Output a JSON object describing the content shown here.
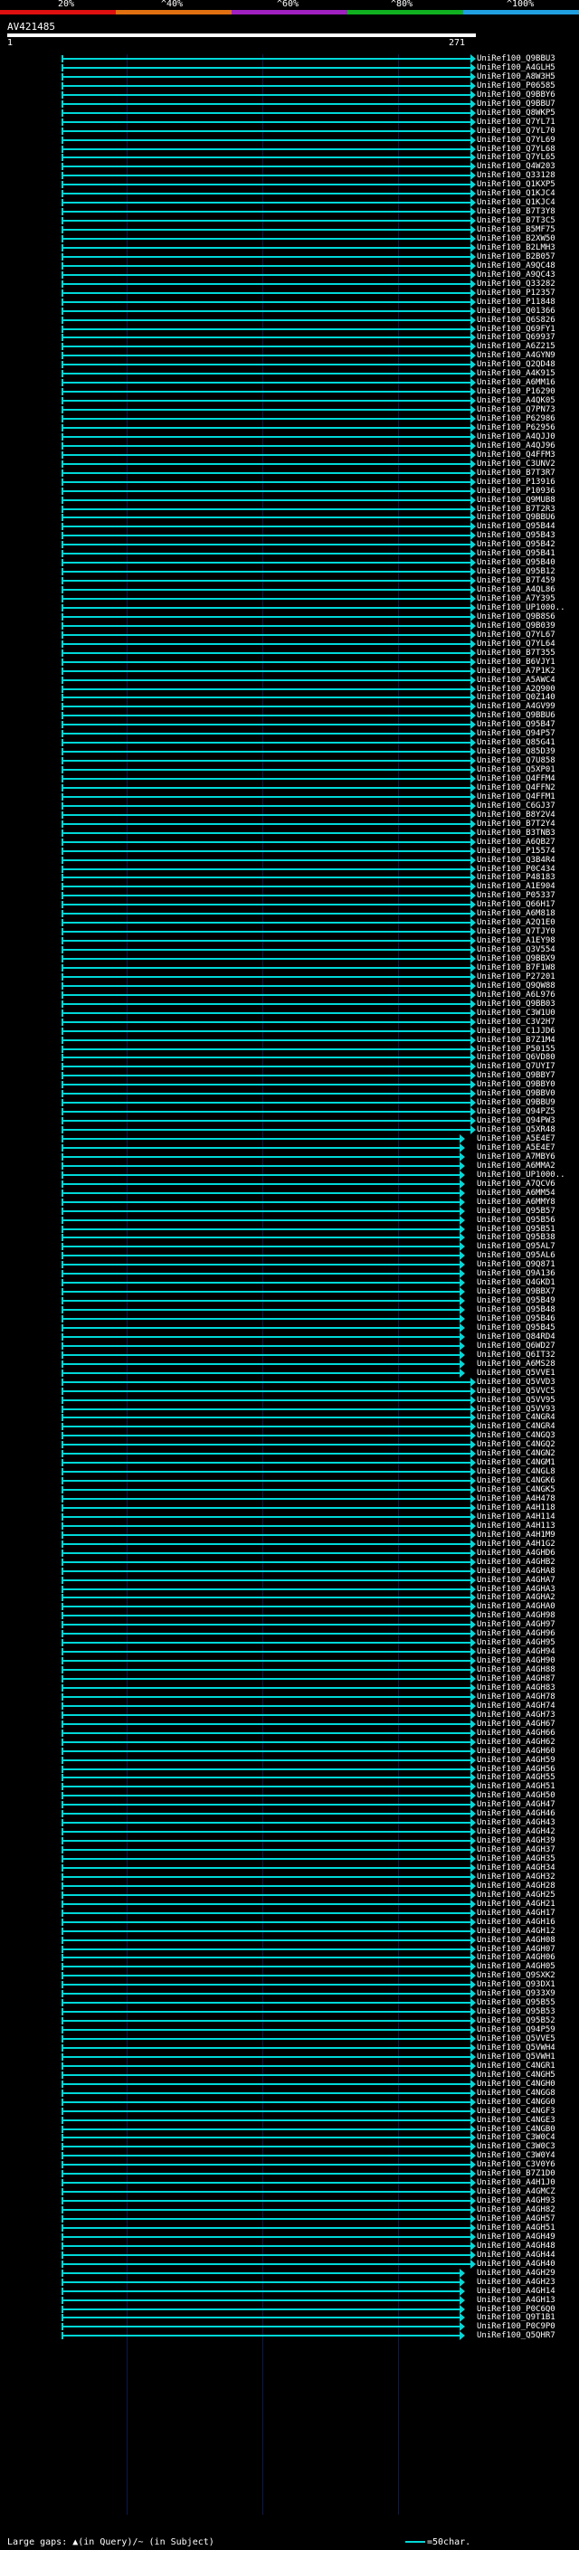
{
  "scale": {
    "labels": [
      "20%",
      "^40%",
      "^60%",
      "^80%",
      "^100%"
    ],
    "colors": [
      "#e01010",
      "#e07010",
      "#a020c0",
      "#10b020",
      "#20a0e0"
    ]
  },
  "query": {
    "title": "AV421485",
    "start": "1",
    "end": "271"
  },
  "hit_color": "#00d8d8",
  "hits": [
    "UniRef100_Q9BBU3",
    "UniRef100_A4GLH5",
    "UniRef100_A8W3H5",
    "UniRef100_P06585",
    "UniRef100_Q9BBY6",
    "UniRef100_Q9BBU7",
    "UniRef100_Q8WKP5",
    "UniRef100_Q7YL71",
    "UniRef100_Q7YL70",
    "UniRef100_Q7YL69",
    "UniRef100_Q7YL68",
    "UniRef100_Q7YL65",
    "UniRef100_Q4W203",
    "UniRef100_Q33128",
    "UniRef100_Q1KXP5",
    "UniRef100_Q1KJC4",
    "UniRef100_Q1KJC4",
    "UniRef100_B7T3Y8",
    "UniRef100_B7T3C5",
    "UniRef100_B5MF75",
    "UniRef100_B2XW50",
    "UniRef100_B2LMH3",
    "UniRef100_B2B057",
    "UniRef100_A9QC48",
    "UniRef100_A9QC43",
    "UniRef100_Q33282",
    "UniRef100_P12357",
    "UniRef100_P11848",
    "UniRef100_Q01366",
    "UniRef100_Q6S826",
    "UniRef100_Q69FY1",
    "UniRef100_Q69937",
    "UniRef100_A6Z215",
    "UniRef100_A4GYN9",
    "UniRef100_Q2QD48",
    "UniRef100_A4K915",
    "UniRef100_A6MM16",
    "UniRef100_P16290",
    "UniRef100_A4QK05",
    "UniRef100_Q7PN73",
    "UniRef100_P62986",
    "UniRef100_P62956",
    "UniRef100_A4QJJ0",
    "UniRef100_A4QJ96",
    "UniRef100_Q4FFM3",
    "UniRef100_C3UNV2",
    "UniRef100_B7T3R7",
    "UniRef100_P13916",
    "UniRef100_P10936",
    "UniRef100_Q9MUB8",
    "UniRef100_B7T2R3",
    "UniRef100_Q9BBU6",
    "UniRef100_Q95B44",
    "UniRef100_Q95B43",
    "UniRef100_Q95B42",
    "UniRef100_Q95B41",
    "UniRef100_Q95B40",
    "UniRef100_Q95B12",
    "UniRef100_B7T459",
    "UniRef100_A4QL86",
    "UniRef100_A7Y395",
    "UniRef100_UP1000..",
    "UniRef100_Q9B8S6",
    "UniRef100_Q9B039",
    "UniRef100_Q7YL67",
    "UniRef100_Q7YL64",
    "UniRef100_B7T355",
    "UniRef100_B6VJY1",
    "UniRef100_A7P1K2",
    "UniRef100_A5AWC4",
    "UniRef100_A2Q900",
    "UniRef100_Q0Z140",
    "UniRef100_A4GV99",
    "UniRef100_Q9BBU6",
    "UniRef100_Q95B47",
    "UniRef100_Q94P57",
    "UniRef100_Q85G41",
    "UniRef100_Q85D39",
    "UniRef100_Q7U858",
    "UniRef100_Q5XP01",
    "UniRef100_Q4FFM4",
    "UniRef100_Q4FFN2",
    "UniRef100_Q4FFM1",
    "UniRef100_C6GJ37",
    "UniRef100_B8Y2V4",
    "UniRef100_B7T2Y4",
    "UniRef100_B3TNB3",
    "UniRef100_A6QB27",
    "UniRef100_P15574",
    "UniRef100_Q3B4R4",
    "UniRef100_P0C434",
    "UniRef100_P48183",
    "UniRef100_A1E904",
    "UniRef100_P05337",
    "UniRef100_Q66H17",
    "UniRef100_A6M818",
    "UniRef100_A2Q1E0",
    "UniRef100_Q7TJY0",
    "UniRef100_A1EY98",
    "UniRef100_Q3V554",
    "UniRef100_Q9BBX9",
    "UniRef100_B7F1W8",
    "UniRef100_P27201",
    "UniRef100_Q9QW88",
    "UniRef100_A6L976",
    "UniRef100_Q9BB03",
    "UniRef100_C3W1U0",
    "UniRef100_C3V2H7",
    "UniRef100_C1JJD6",
    "UniRef100_B7Z1M4",
    "UniRef100_P50155",
    "UniRef100_Q6VD80",
    "UniRef100_Q7UYI7",
    "UniRef100_Q9BBY7",
    "UniRef100_Q9BBY0",
    "UniRef100_Q9BBV0",
    "UniRef100_Q9BBU9",
    "UniRef100_Q94PZ5",
    "UniRef100_Q94PW3",
    "UniRef100_Q5XR48",
    "UniRef100_A5E4E7",
    "UniRef100_A5E4E7",
    "UniRef100_A7MBY6",
    "UniRef100_A6MMA2",
    "UniRef100_UP1000..",
    "UniRef100_A7QCV6",
    "UniRef100_A6MM54",
    "UniRef100_A6MMY8",
    "UniRef100_Q95B57",
    "UniRef100_Q95B56",
    "UniRef100_Q95B51",
    "UniRef100_Q95B38",
    "UniRef100_Q95AL7",
    "UniRef100_Q95AL6",
    "UniRef100_Q9Q871",
    "UniRef100_Q9A136",
    "UniRef100_Q4GKD1",
    "UniRef100_Q9BBX7",
    "UniRef100_Q95B49",
    "UniRef100_Q95B48",
    "UniRef100_Q95B46",
    "UniRef100_Q95B45",
    "UniRef100_Q84RD4",
    "UniRef100_Q6WD27",
    "UniRef100_Q6IT32",
    "UniRef100_A6MS28",
    "UniRef100_Q5VVE1",
    "UniRef100_Q5VVD3",
    "UniRef100_Q5VVC5",
    "UniRef100_Q5VV95",
    "UniRef100_Q5VV93",
    "UniRef100_C4NGR4",
    "UniRef100_C4NGR4",
    "UniRef100_C4NGQ3",
    "UniRef100_C4NGQ2",
    "UniRef100_C4NGN2",
    "UniRef100_C4NGM1",
    "UniRef100_C4NGL8",
    "UniRef100_C4NGK6",
    "UniRef100_C4NGK5",
    "UniRef100_A4H478",
    "UniRef100_A4H118",
    "UniRef100_A4H114",
    "UniRef100_A4H113",
    "UniRef100_A4H1M9",
    "UniRef100_A4H1G2",
    "UniRef100_A4GHD6",
    "UniRef100_A4GHB2",
    "UniRef100_A4GHA8",
    "UniRef100_A4GHA7",
    "UniRef100_A4GHA3",
    "UniRef100_A4GHA2",
    "UniRef100_A4GHA0",
    "UniRef100_A4GH98",
    "UniRef100_A4GH97",
    "UniRef100_A4GH96",
    "UniRef100_A4GH95",
    "UniRef100_A4GH94",
    "UniRef100_A4GH90",
    "UniRef100_A4GH88",
    "UniRef100_A4GH87",
    "UniRef100_A4GH83",
    "UniRef100_A4GH78",
    "UniRef100_A4GH74",
    "UniRef100_A4GH73",
    "UniRef100_A4GH67",
    "UniRef100_A4GH66",
    "UniRef100_A4GH62",
    "UniRef100_A4GH60",
    "UniRef100_A4GH59",
    "UniRef100_A4GH56",
    "UniRef100_A4GH55",
    "UniRef100_A4GH51",
    "UniRef100_A4GH50",
    "UniRef100_A4GH47",
    "UniRef100_A4GH46",
    "UniRef100_A4GH43",
    "UniRef100_A4GH42",
    "UniRef100_A4GH39",
    "UniRef100_A4GH37",
    "UniRef100_A4GH35",
    "UniRef100_A4GH34",
    "UniRef100_A4GH32",
    "UniRef100_A4GH28",
    "UniRef100_A4GH25",
    "UniRef100_A4GH21",
    "UniRef100_A4GH17",
    "UniRef100_A4GH16",
    "UniRef100_A4GH12",
    "UniRef100_A4GH08",
    "UniRef100_A4GH07",
    "UniRef100_A4GH06",
    "UniRef100_A4GH05",
    "UniRef100_Q9SXK2",
    "UniRef100_Q93DX1",
    "UniRef100_Q933X9",
    "UniRef100_Q95B55",
    "UniRef100_Q95B53",
    "UniRef100_Q95B52",
    "UniRef100_Q94P59",
    "UniRef100_Q5VVE5",
    "UniRef100_Q5VWH4",
    "UniRef100_Q5VWH1",
    "UniRef100_C4NGR1",
    "UniRef100_C4NGH5",
    "UniRef100_C4NGH0",
    "UniRef100_C4NGG8",
    "UniRef100_C4NGG0",
    "UniRef100_C4NGF3",
    "UniRef100_C4NGE3",
    "UniRef100_C4NGB0",
    "UniRef100_C3W0C4",
    "UniRef100_C3W0C3",
    "UniRef100_C3W0Y4",
    "UniRef100_C3V0Y6",
    "UniRef100_B7Z1D0",
    "UniRef100_A4H1J0",
    "UniRef100_A4GMCZ",
    "UniRef100_A4GH93",
    "UniRef100_A4GH82",
    "UniRef100_A4GH57",
    "UniRef100_A4GH51",
    "UniRef100_A4GH49",
    "UniRef100_A4GH48",
    "UniRef100_A4GH44",
    "UniRef100_A4GH40",
    "UniRef100_A4GH29",
    "UniRef100_A4GH23",
    "UniRef100_A4GH14",
    "UniRef100_A4GH13",
    "UniRef100_P0C6Q0",
    "UniRef100_Q9T1B1",
    "UniRef100_P0C9P0",
    "UniRef100_Q5QHR7"
  ],
  "short_hits": [
    120,
    121,
    122,
    123,
    124,
    125,
    126,
    127,
    128,
    129,
    130,
    131,
    132,
    133,
    134,
    135,
    136,
    137,
    138,
    139,
    140,
    141,
    142,
    143,
    144,
    145,
    146,
    246,
    247,
    248,
    249,
    250,
    251,
    252,
    253,
    254,
    255,
    256,
    257,
    258,
    259,
    260,
    261,
    262,
    263,
    264,
    265,
    266,
    267,
    268,
    269,
    270,
    271,
    272,
    273,
    274,
    275,
    276,
    277,
    278,
    279
  ],
  "legend": {
    "text": "Large gaps: ▲(in Query)/~ (in Subject)",
    "right": "=50char."
  }
}
